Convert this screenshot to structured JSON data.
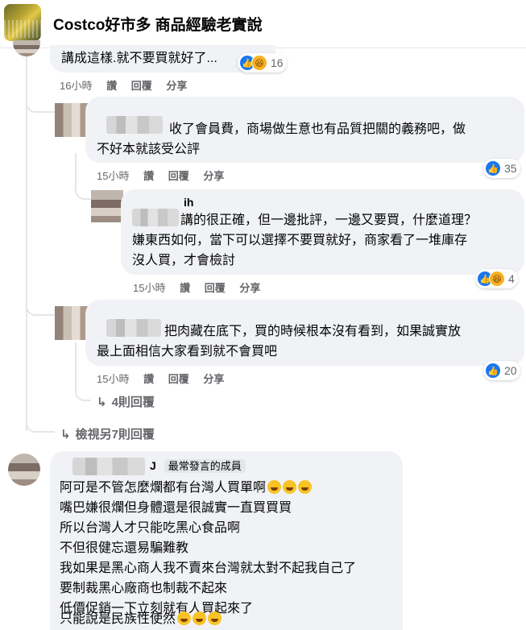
{
  "header": {
    "group_name": "Costco好市多 商品經驗老實說"
  },
  "comments": [
    {
      "text": "講成這樣.就不要買就好了...",
      "time": "16小時",
      "like": "讚",
      "reply": "回覆",
      "share": "分享",
      "reaction_count": "16"
    },
    {
      "text_line1": "收了會員費，商場做生意也有品質把關的義務吧，做",
      "text_line2": "不好本就該受公評",
      "time": "15小時",
      "like": "讚",
      "reply": "回覆",
      "share": "分享",
      "reaction_count": "35"
    },
    {
      "name": "ih",
      "text_line1": "講的很正確，但一邊批評，一邊又要買，什麼道理？",
      "text_line2": "嫌東西如何，當下可以選擇不要買就好，商家看了一堆庫存",
      "text_line3": "沒人買，才會檢討",
      "time": "15小時",
      "like": "讚",
      "reply": "回覆",
      "share": "分享",
      "reaction_count": "4"
    },
    {
      "text_line1": "把肉藏在底下，買的時候根本沒有看到，如果誠實放",
      "text_line2": "最上面相信大家看到就不會買吧",
      "time": "15小時",
      "like": "讚",
      "reply": "回覆",
      "share": "分享",
      "reaction_count": "20"
    }
  ],
  "replies_link": "4則回覆",
  "view_more": "檢視另7則回覆",
  "last_comment": {
    "name_suffix": "J",
    "badge": "最常發言的成員",
    "lines": [
      "阿可是不管怎麼爛都有台灣人買單啊",
      "嘴巴嫌很爛但身體還是很誠實一直買買買",
      "所以台灣人才只能吃黑心食品啊",
      "不但很健忘還易騙難教",
      "我如果是黑心商人我不賣來台灣就太對不起我自己了",
      "要制裁黑心廠商也制裁不起來",
      "低價促銷一下立刻就有人買起來了",
      "只能說是民族性使然"
    ]
  },
  "colors": {
    "like_blue": "#1877f2",
    "haha_yellow": "#f7b125",
    "bubble_bg": "#f0f2f5",
    "meta_gray": "#65676b"
  },
  "icons": [
    "like-icon",
    "haha-icon",
    "reply-arrow-icon",
    "laughing-emoji-icon",
    "rofl-emoji-icon"
  ]
}
